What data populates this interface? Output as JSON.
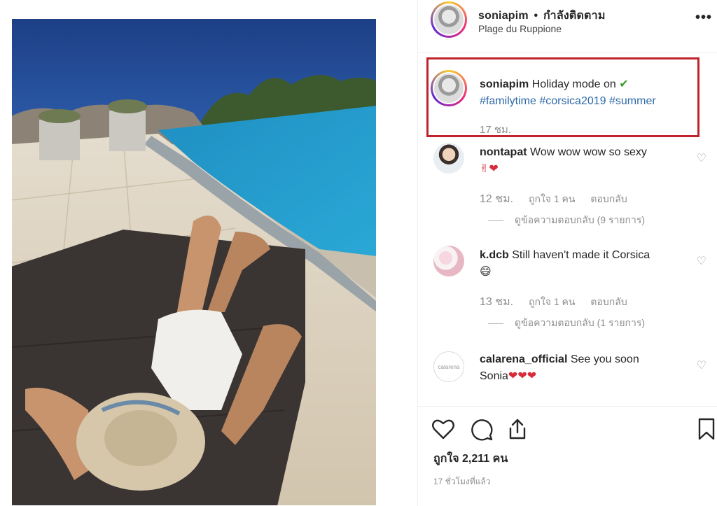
{
  "post": {
    "username": "soniapim",
    "separator": "•",
    "follow_status": "กำลังติดตาม",
    "location": "Plage du Ruppione",
    "more_label": "•••"
  },
  "caption": {
    "username": "soniapim",
    "text": "Holiday mode on",
    "check": "✔",
    "hashtags": [
      "#familytime",
      "#corsica2019",
      "#summer"
    ],
    "time": "17 ชม."
  },
  "comments": [
    {
      "username": "nontapat",
      "text": "Wow wow wow so sexy",
      "emoji": "✌❤",
      "time": "12 ชม.",
      "likes": "ถูกใจ 1 คน",
      "reply": "ตอบกลับ",
      "view_replies": "ดูข้อความตอบกลับ (9 รายการ)"
    },
    {
      "username": "k.dcb",
      "text": "Still haven't made it Corsica",
      "emoji": "😄",
      "time": "13 ชม.",
      "likes": "ถูกใจ 1 คน",
      "reply": "ตอบกลับ",
      "view_replies": "ดูข้อความตอบกลับ (1 รายการ)"
    },
    {
      "username": "calarena_official",
      "text": "See you soon",
      "text2": "Sonia",
      "emoji": "❤❤❤",
      "avatar_text": "calarena"
    }
  ],
  "actions": {
    "likes": "ถูกใจ 2,211 คน",
    "ago": "17 ชั่วโมงที่แล้ว"
  },
  "colors": {
    "highlight_border": "#c0232a",
    "hashtag": "#2f6aa8",
    "check": "#3a9c2e",
    "secondary_text": "#8e8e8e"
  }
}
